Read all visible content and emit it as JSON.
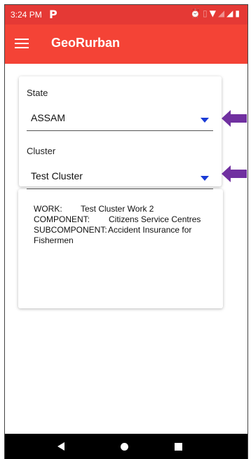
{
  "status_bar": {
    "time": "3:24 PM",
    "notification_glyph": "P",
    "icons": [
      "alarm-icon",
      "vibrate-icon",
      "wifi-icon",
      "signal-icon",
      "signal-icon",
      "battery-icon"
    ]
  },
  "app_bar": {
    "title": "GeoRurban",
    "menu_icon": "hamburger-menu-icon",
    "color": "#f44336"
  },
  "form": {
    "state": {
      "label": "State",
      "value": "ASSAM"
    },
    "cluster": {
      "label": "Cluster",
      "value": "Test Cluster"
    }
  },
  "details": {
    "work_label": "WORK:",
    "work_value": "Test Cluster Work 2",
    "component_label": "COMPONENT:",
    "component_value": "Citizens Service Centres",
    "subcomponent_label": "SUBCOMPONENT:",
    "subcomponent_value": "Accident Insurance for",
    "subcomponent_value_cont": "Fishermen"
  },
  "nav_bar": {
    "icons": [
      "back-icon",
      "home-icon",
      "recents-icon"
    ]
  },
  "colors": {
    "status_bar": "#e53935",
    "dropdown_caret": "#1a3bd6",
    "annotation_arrow": "#7030a0"
  }
}
